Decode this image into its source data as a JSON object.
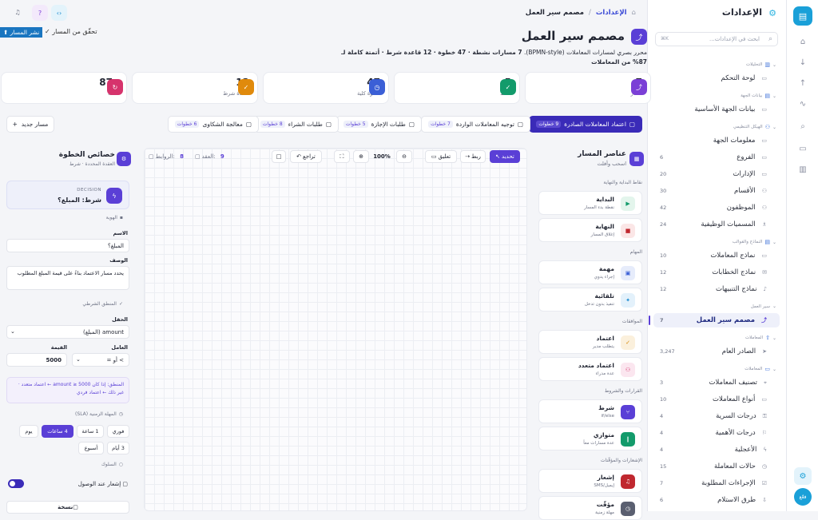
{
  "rail": {
    "logo": "chat-icon",
    "chat_label": "فعّع"
  },
  "sidebar": {
    "title": "الإعدادات",
    "search_placeholder": "ابحث في الإعدادات...",
    "search_kbd": "K⌘",
    "groups": [
      {
        "label": "التحليلات"
      },
      {
        "label": "بيانات الجهة"
      },
      {
        "label": "الهيكل التنظيمي"
      },
      {
        "label": "النماذج والقوالب"
      },
      {
        "label": "سير العمل"
      },
      {
        "label": "المعاملات"
      },
      {
        "label": "المعاملات"
      }
    ],
    "items": [
      {
        "label": "لوحة التحكم",
        "count": ""
      },
      {
        "label": "بيانات الجهة الأساسية",
        "count": ""
      },
      {
        "label": "معلومات الجهة",
        "count": ""
      },
      {
        "label": "الفروع",
        "count": "6"
      },
      {
        "label": "الإدارات",
        "count": "20"
      },
      {
        "label": "الأقسام",
        "count": "30"
      },
      {
        "label": "الموظفون",
        "count": "42"
      },
      {
        "label": "المسميات الوظيفية",
        "count": "24"
      },
      {
        "label": "نماذج المعاملات",
        "count": "10"
      },
      {
        "label": "نماذج الخطابات",
        "count": "12"
      },
      {
        "label": "نماذج التنبيهات",
        "count": "12"
      },
      {
        "label": "مصمم سير العمل",
        "count": "7"
      },
      {
        "label": "الصادر العام",
        "count": "3,247"
      },
      {
        "label": "تصنيف المعاملات",
        "count": "3"
      },
      {
        "label": "أنواع المعاملات",
        "count": "10"
      },
      {
        "label": "درجات السرية",
        "count": "4"
      },
      {
        "label": "درجات الأهمية",
        "count": "4"
      },
      {
        "label": "الأعجلية",
        "count": "4"
      },
      {
        "label": "حالات المعاملة",
        "count": "15"
      },
      {
        "label": "الإجراءات المطلوبة",
        "count": "7"
      },
      {
        "label": "طرق الاستلام",
        "count": "6"
      }
    ]
  },
  "breadcrumb": {
    "root": "الإعدادات",
    "current": "مصمم سير العمل"
  },
  "page": {
    "title": "مصمم سير العمل",
    "desc_a": "محرر بصري لمسارات المعاملات (BPMN-style). ",
    "desc_b": "7 مسارات نشطة · 47 خطوة · 12 قاعدة شرط · أتمتة كاملة لـ 87% من المعاملات",
    "publish": "نشر المسار",
    "verify": "تحقّق من المسار"
  },
  "stats": [
    {
      "num": "7",
      "label": "مسار",
      "color": "#7b3fd6"
    },
    {
      "num": "5",
      "label": "نشط",
      "color": "#139b6b"
    },
    {
      "num": "47",
      "label": "خطوة كلية",
      "color": "#3b5fd6"
    },
    {
      "num": "12",
      "label": "قاعدة شرط",
      "color": "#e08a0c"
    },
    {
      "num": "87",
      "suffix": "%",
      "label": "أتمتة",
      "color": "#d6336c"
    }
  ],
  "tabs": [
    {
      "label": "اعتماد المعاملات الصادرة",
      "badge": "9 خطوات",
      "active": true
    },
    {
      "label": "توجيه المعاملات الواردة",
      "badge": "7 خطوات"
    },
    {
      "label": "طلبات الإجازة",
      "badge": "5 خطوات"
    },
    {
      "label": "طلبات الشراء",
      "badge": "8 خطوات"
    },
    {
      "label": "معالجة الشكاوى",
      "badge": "6 خطوات"
    }
  ],
  "new_path": "مسار جديد",
  "palette": {
    "title": "عناصر المسار",
    "subtitle": "اسحب وأفلت",
    "sections": [
      "نقاط البداية والنهاية",
      "المهام",
      "الموافقات",
      "القرارات والشروط",
      "الإشعارات والمؤقّتات"
    ],
    "items": [
      {
        "t": "البداية",
        "s": "نقطة بدء المسار",
        "bg": "#e3f5ec",
        "fg": "#139b6b"
      },
      {
        "t": "النهاية",
        "s": "إغلاق المسار",
        "bg": "#fbe6e6",
        "fg": "#c0282f"
      },
      {
        "t": "مهمة",
        "s": "إجراء يدوي",
        "bg": "#e6ecfb",
        "fg": "#3b5fd6"
      },
      {
        "t": "تلقائية",
        "s": "تنفيذ بدون تدخل",
        "bg": "#e3f1fb",
        "fg": "#1a8ad0"
      },
      {
        "t": "اعتماد",
        "s": "يتطلب مدير",
        "bg": "#fbf0dc",
        "fg": "#d68a0c"
      },
      {
        "t": "اعتماد متعدد",
        "s": "عدة مدراء",
        "bg": "#fbe6ef",
        "fg": "#d6336c"
      },
      {
        "t": "شرط",
        "s": "if/else",
        "bg": "#efe8fb",
        "fg": "#5a3fd6"
      },
      {
        "t": "متوازي",
        "s": "عدة مسارات معاً",
        "bg": "#e3f5ec",
        "fg": "#139b6b"
      },
      {
        "t": "إشعار",
        "s": "إيميل/SMS",
        "bg": "#fbe6e6",
        "fg": "#c0282f"
      },
      {
        "t": "مؤقّت",
        "s": "مهلة زمنية",
        "bg": "#eceef3",
        "fg": "#5a5f70"
      }
    ]
  },
  "toolbar": {
    "select": "تحديد",
    "link": "ربط",
    "comment": "تعليق",
    "undo": "تراجع",
    "zoom": "100%",
    "nodes_label": "العقد:",
    "nodes": "9",
    "links_label": "الروابط:",
    "links": "8"
  },
  "props": {
    "title": "خصائص الخطوة",
    "subtitle": "العقدة المحددة · شرط",
    "type": "DECISION",
    "node_name": "شرط: المبلغ؟",
    "sec_identity": "الهوية",
    "name_label": "الاسم",
    "name_value": "المبلغ؟",
    "desc_label": "الوصف",
    "desc_value": "يحدد مسار الاعتماد بناءً على قيمة المبلغ المطلوب",
    "sec_logic": "المنطق الشرطي",
    "field_label": "الحقل",
    "field_value": "amount (المبلغ)",
    "op_label": "العامل",
    "op_value": "> أو =",
    "val_label": "القيمة",
    "val_value": "5000",
    "logic_text": "المنطق: إذا كان amount ≥ 5000 ← اعتماد متعدد · غير ذلك ← اعتماد فردي",
    "sec_sla": "المهلة الزمنية (SLA)",
    "sla": [
      "فوري",
      "1 ساعة",
      "4 ساعات",
      "يوم",
      "3 أيام",
      "أسبوع"
    ],
    "sec_behavior": "السلوك",
    "notify_label": "إشعار عند الوصول",
    "copy": "نسخة"
  }
}
